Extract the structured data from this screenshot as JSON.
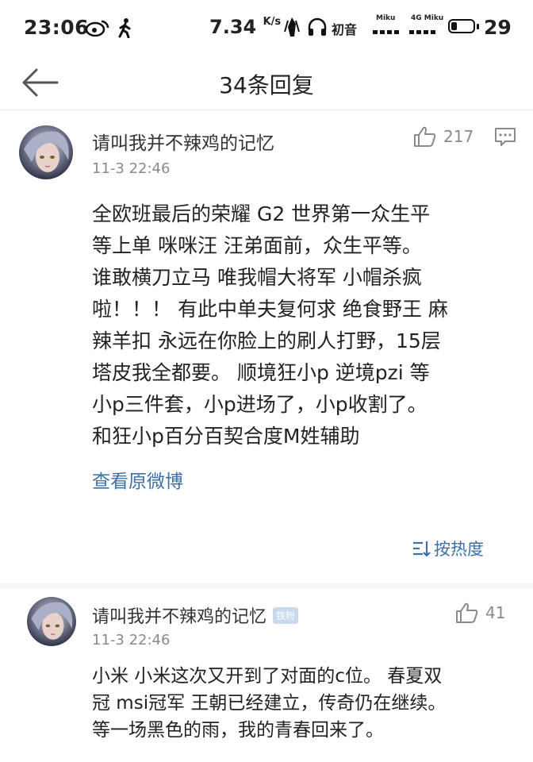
{
  "status_bar": {
    "time": "23:06",
    "speed": "7.34",
    "speed_unit": "K/s",
    "carrier": "初音",
    "net1": "Miku",
    "net2": "4G Miku",
    "battery_level": 29
  },
  "header": {
    "title": "34条回复"
  },
  "comments": [
    {
      "username": "请叫我并不辣鸡的记忆",
      "time": "11-3 22:46",
      "likes": "217",
      "lines": [
        "全欧班最后的荣耀 G2  世界第一众生平",
        "等上单 咪咪汪  汪弟面前，众生平等。",
        "谁敢横刀立马 唯我帽大将军  小帽杀疯",
        "啦！！！ 有此中单夫复何求  绝食野王 麻",
        "辣羊扣  永远在你脸上的刷人打野，15层",
        "塔皮我全都要。  顺境狂小p  逆境pzi  等",
        "小p三件套，小p进场了，小p收割了。",
        "和狂小p百分百契合度M姓辅助"
      ],
      "view_original": "查看原微博",
      "sort_label": "按热度"
    },
    {
      "username": "请叫我并不辣鸡的记忆",
      "badge": "铁粉",
      "time": "11-3 22:46",
      "likes": "41",
      "lines": [
        "小米 小米这次又开到了对面的c位。 春夏双",
        "冠 msi冠军  王朝已经建立，传奇仍在继续。",
        "等一场黑色的雨，我的青春回来了。"
      ]
    }
  ]
}
